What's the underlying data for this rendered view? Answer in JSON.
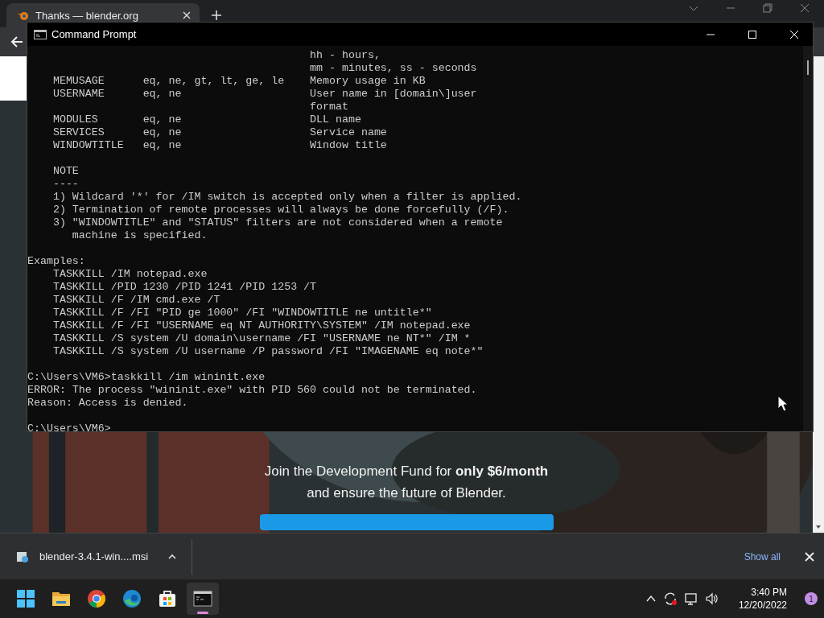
{
  "browser": {
    "tab": {
      "title": "Thanks — blender.org",
      "selected": true
    }
  },
  "page": {
    "promo_lines": [
      "Join the Development Fund for **only $6/month**",
      "and ensure the future of Blender."
    ]
  },
  "console": {
    "title": "Command Prompt",
    "blocks": [
      [
        "                                            hh - hours,",
        "                                            mm - minutes, ss - seconds",
        "    MEMUSAGE      eq, ne, gt, lt, ge, le    Memory usage in KB",
        "    USERNAME      eq, ne                    User name in [domain\\]user",
        "                                            format",
        "    MODULES       eq, ne                    DLL name",
        "    SERVICES      eq, ne                    Service name",
        "    WINDOWTITLE   eq, ne                    Window title"
      ],
      [
        "    NOTE",
        "    ----",
        "    1) Wildcard '*' for /IM switch is accepted only when a filter is applied.",
        "    2) Termination of remote processes will always be done forcefully (/F).",
        "    3) \"WINDOWTITLE\" and \"STATUS\" filters are not considered when a remote",
        "       machine is specified."
      ],
      [
        "Examples:",
        "    TASKKILL /IM notepad.exe",
        "    TASKKILL /PID 1230 /PID 1241 /PID 1253 /T",
        "    TASKKILL /F /IM cmd.exe /T",
        "    TASKKILL /F /FI \"PID ge 1000\" /FI \"WINDOWTITLE ne untitle*\"",
        "    TASKKILL /F /FI \"USERNAME eq NT AUTHORITY\\SYSTEM\" /IM notepad.exe",
        "    TASKKILL /S system /U domain\\username /FI \"USERNAME ne NT*\" /IM *",
        "    TASKKILL /S system /U username /P password /FI \"IMAGENAME eq note*\""
      ],
      [
        "C:\\Users\\VM6>taskkill /im wininit.exe",
        "ERROR: The process \"wininit.exe\" with PID 560 could not be terminated.",
        "Reason: Access is denied."
      ],
      [
        "C:\\Users\\VM6>"
      ]
    ]
  },
  "downloads": {
    "file": "blender-3.4.1-win....msi",
    "show_all": "Show all"
  },
  "taskbar": {
    "apps": [
      {
        "kind": "start",
        "selected": false
      },
      {
        "kind": "folder",
        "selected": false
      },
      {
        "kind": "chrome",
        "selected": false
      },
      {
        "kind": "edge",
        "selected": false
      },
      {
        "kind": "store",
        "selected": false
      },
      {
        "kind": "terminal",
        "selected": true
      }
    ],
    "time": "3:40 PM",
    "date": "12/20/2022",
    "notifications": "1"
  }
}
